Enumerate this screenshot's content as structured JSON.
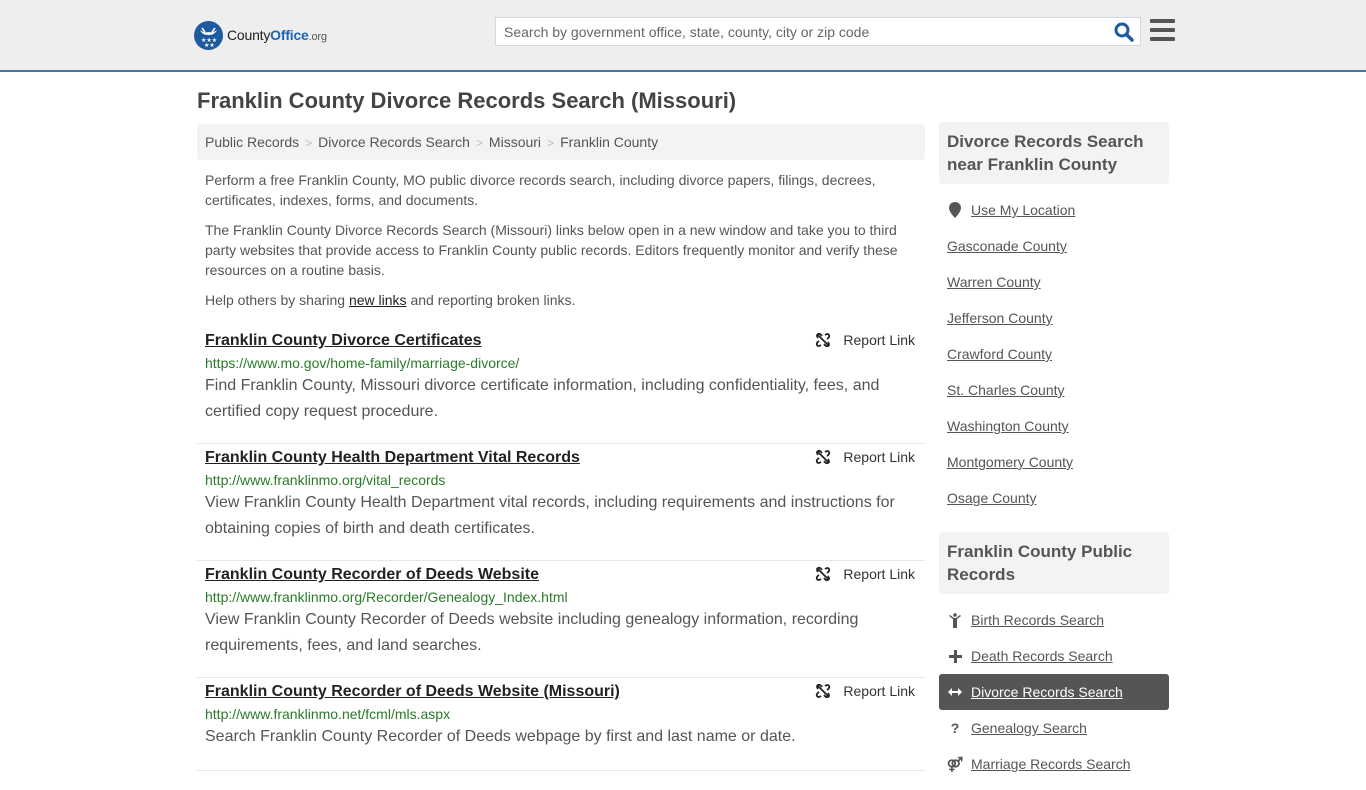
{
  "header": {
    "logo": {
      "name_part1": "County",
      "name_part2": "Office",
      "tld": ".org"
    },
    "search": {
      "placeholder": "Search by government office, state, county, city or zip code",
      "value": ""
    },
    "brand_color": "#1e5aa0",
    "accent_border": "#3b78aa"
  },
  "page": {
    "title": "Franklin County Divorce Records Search (Missouri)",
    "breadcrumb": [
      "Public Records",
      "Divorce Records Search",
      "Missouri",
      "Franklin County"
    ],
    "intro": {
      "p1": "Perform a free Franklin County, MO public divorce records search, including divorce papers, filings, decrees, certificates, indexes, forms, and documents.",
      "p2": "The Franklin County Divorce Records Search (Missouri) links below open in a new window and take you to third party websites that provide access to Franklin County public records. Editors frequently monitor and verify these resources on a routine basis.",
      "p3_before": "Help others by sharing ",
      "p3_link": "new links",
      "p3_after": " and reporting broken links."
    }
  },
  "results": [
    {
      "title": "Franklin County Divorce Certificates",
      "url": "https://www.mo.gov/home-family/marriage-divorce/",
      "description": "Find Franklin County, Missouri divorce certificate information, including confidentiality, fees, and certified copy request procedure.",
      "report_label": "Report Link"
    },
    {
      "title": "Franklin County Health Department Vital Records",
      "url": "http://www.franklinmo.org/vital_records",
      "description": "View Franklin County Health Department vital records, including requirements and instructions for obtaining copies of birth and death certificates.",
      "report_label": "Report Link"
    },
    {
      "title": "Franklin County Recorder of Deeds Website",
      "url": "http://www.franklinmo.org/Recorder/Genealogy_Index.html",
      "description": "View Franklin County Recorder of Deeds website including genealogy information, recording requirements, fees, and land searches.",
      "report_label": "Report Link"
    },
    {
      "title": "Franklin County Recorder of Deeds Website (Missouri)",
      "url": "http://www.franklinmo.net/fcml/mls.aspx",
      "description": "Search Franklin County Recorder of Deeds webpage by first and last name or date.",
      "report_label": "Report Link"
    }
  ],
  "sidebar": {
    "nearby": {
      "heading": "Divorce Records Search near Franklin County",
      "use_location": "Use My Location",
      "counties": [
        "Gasconade County",
        "Warren County",
        "Jefferson County",
        "Crawford County",
        "St. Charles County",
        "Washington County",
        "Montgomery County",
        "Osage County"
      ]
    },
    "public_records": {
      "heading": "Franklin County Public Records",
      "items": [
        {
          "label": "Birth Records Search",
          "icon": "child-icon",
          "active": false
        },
        {
          "label": "Death Records Search",
          "icon": "cross-icon",
          "active": false
        },
        {
          "label": "Divorce Records Search",
          "icon": "arrows-horizontal-icon",
          "active": true
        },
        {
          "label": "Genealogy Search",
          "icon": "question-icon",
          "active": false
        },
        {
          "label": "Marriage Records Search",
          "icon": "gender-icon",
          "active": false
        }
      ]
    }
  }
}
